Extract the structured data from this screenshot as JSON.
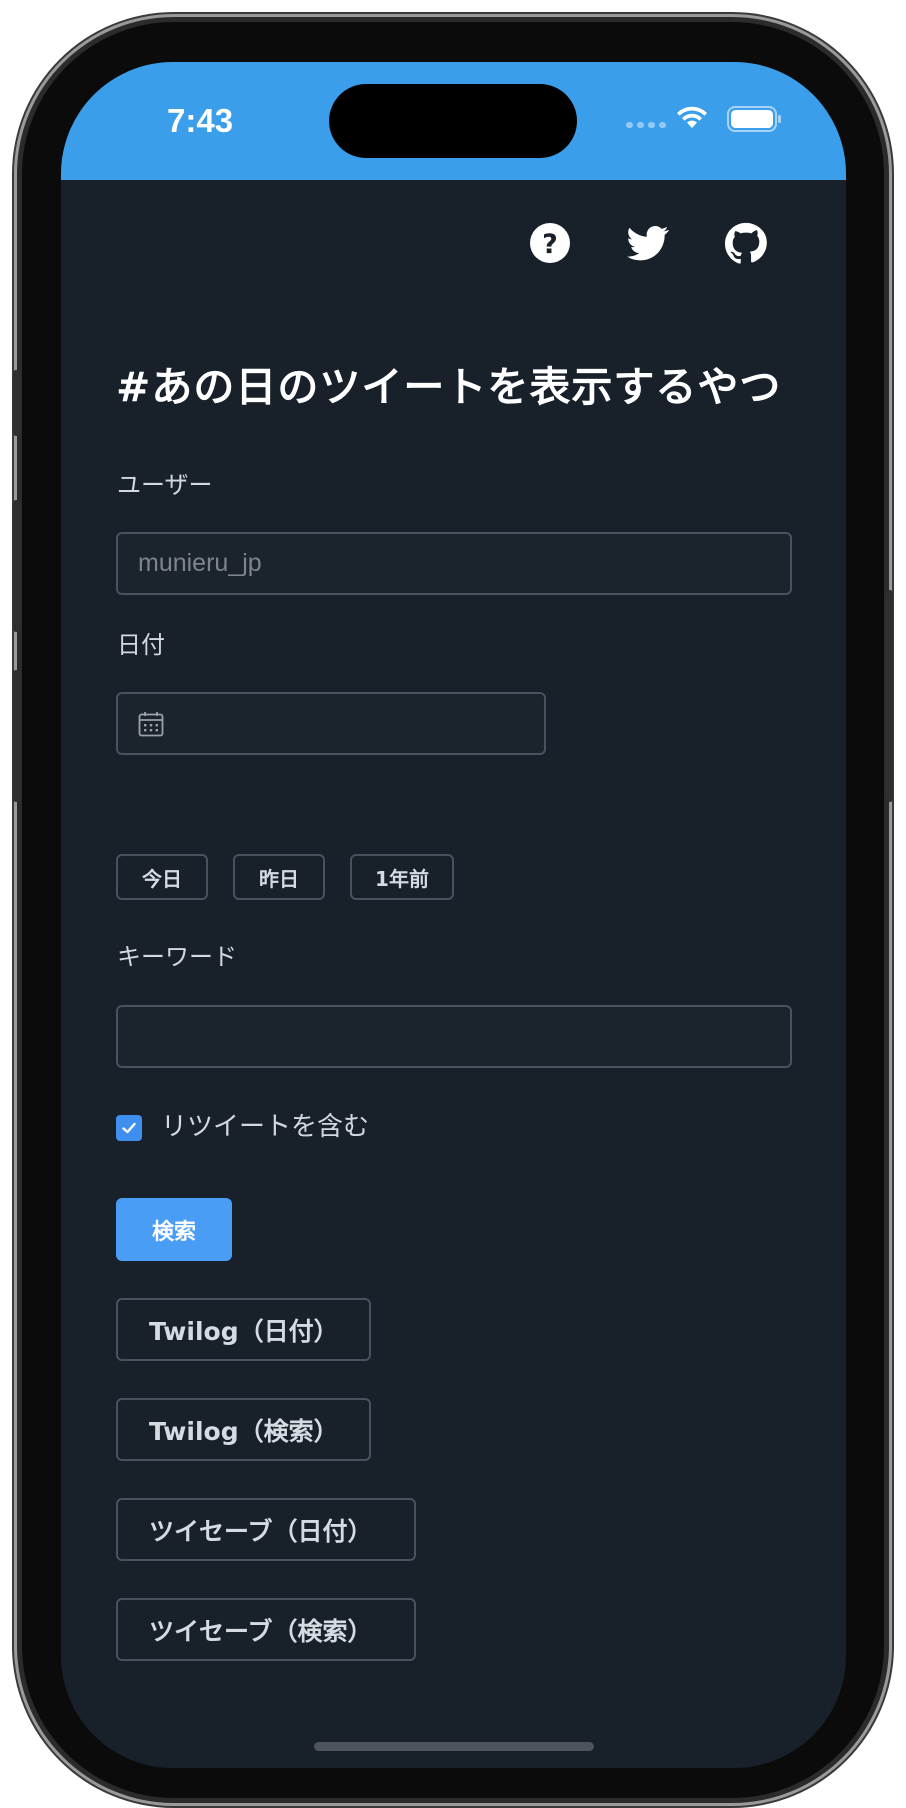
{
  "status_bar": {
    "time": "7:43"
  },
  "header_icons": [
    "help-icon",
    "twitter-icon",
    "github-icon"
  ],
  "page": {
    "title": "#あの日のツイートを表示するやつ"
  },
  "form": {
    "user": {
      "label": "ユーザー",
      "placeholder": "munieru_jp",
      "value": ""
    },
    "date": {
      "label": "日付",
      "value": ""
    },
    "date_shortcuts": [
      "今日",
      "昨日",
      "1年前"
    ],
    "keyword": {
      "label": "キーワード",
      "value": ""
    },
    "include_retweets": {
      "label": "リツイートを含む",
      "checked": true
    },
    "search_label": "検索"
  },
  "external_links": [
    "Twilog（日付）",
    "Twilog（検索）",
    "ツイセーブ（日付）",
    "ツイセーブ（検索）"
  ],
  "colors": {
    "status_bar": "#3b9eea",
    "background": "#18202a",
    "primary": "#4a9df5"
  }
}
